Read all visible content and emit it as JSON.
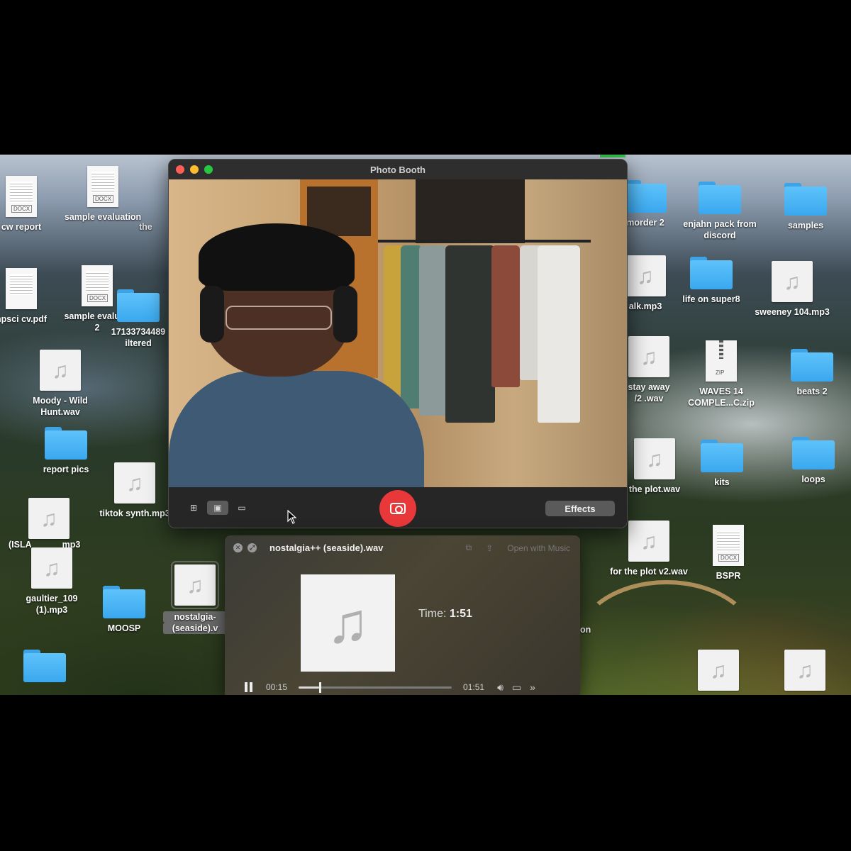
{
  "desktop": {
    "icons": [
      {
        "name": "cw report",
        "kind": "doc",
        "doc_tag": "DOCX"
      },
      {
        "name": "sample evaluation",
        "kind": "doc",
        "doc_tag": "DOCX"
      },
      {
        "name": "the",
        "kind": "partial"
      },
      {
        "name": "npsci cv.pdf",
        "kind": "doc",
        "doc_tag": ""
      },
      {
        "name": "sample evaluati",
        "name2": "2",
        "kind": "doc",
        "doc_tag": "DOCX"
      },
      {
        "name": "17133734489",
        "name2": "iltered",
        "kind": "folder"
      },
      {
        "name": "Moody - Wild",
        "name2": "Hunt.wav",
        "kind": "audio"
      },
      {
        "name": "report pics",
        "kind": "folder"
      },
      {
        "name": "tiktok synth.mp3",
        "kind": "audio"
      },
      {
        "name": "(ISLA",
        "kind": "audio",
        "suffix": "mp3"
      },
      {
        "name": "gaultier_109",
        "name2": "(1).mp3",
        "kind": "audio"
      },
      {
        "name": "MOOSP",
        "kind": "folder"
      },
      {
        "name": "nostalgia-",
        "name2": "(seaside).v",
        "kind": "audio"
      },
      {
        "name": "",
        "kind": "folder"
      },
      {
        "name": "morder 2",
        "kind": "folder"
      },
      {
        "name": "enjahn pack from",
        "name2": "discord",
        "kind": "folder"
      },
      {
        "name": "samples",
        "kind": "folder"
      },
      {
        "name": "alk.mp3",
        "kind": "audio"
      },
      {
        "name": "life on super8",
        "kind": "folder"
      },
      {
        "name": "sweeney 104.mp3",
        "kind": "audio"
      },
      {
        "name": "stay away",
        "name2": "/2 .wav",
        "kind": "audio"
      },
      {
        "name": "WAVES 14",
        "name2": "COMPLE...C.zip",
        "kind": "zip",
        "zip_tag": "ZIP"
      },
      {
        "name": "beats 2",
        "kind": "folder"
      },
      {
        "name": "the plot.wav",
        "kind": "audio"
      },
      {
        "name": "kits",
        "kind": "folder"
      },
      {
        "name": "loops",
        "kind": "folder"
      },
      {
        "name": "for the plot v2.wav",
        "kind": "audio"
      },
      {
        "name": "BSPR",
        "kind": "doc",
        "doc_tag": "DOCX"
      },
      {
        "name": "on",
        "kind": "partial"
      }
    ]
  },
  "photo_booth": {
    "title": "Photo Booth",
    "effects_label": "Effects",
    "view_modes": [
      "grid-icon",
      "single-photo-icon",
      "video-icon"
    ],
    "shutter_icon": "camera-icon",
    "shutter_color": "#e8383a"
  },
  "quick_look": {
    "filename": "nostalgia++ (seaside).wav",
    "open_with": "Open with Music",
    "time_label": "Time:",
    "time_value": "1:51",
    "current_time": "00:15",
    "duration": "01:51",
    "progress": 0.135
  },
  "colors": {
    "close": "#ff5f57",
    "minimize": "#febc2e",
    "zoom": "#28c840",
    "folder": "#4fb6f6"
  }
}
